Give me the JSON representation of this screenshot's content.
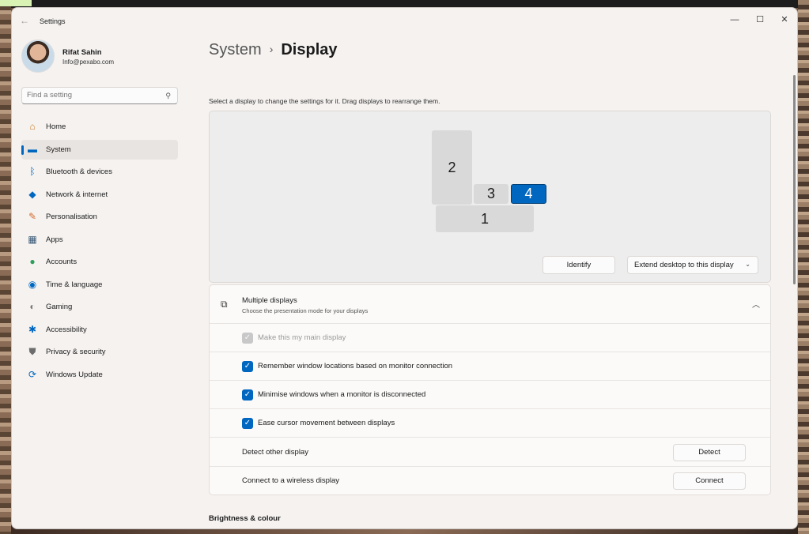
{
  "window": {
    "title": "Settings",
    "controls": {
      "minimize": "—",
      "maximize": "☐",
      "close": "✕"
    }
  },
  "profile": {
    "name": "Rifat Sahin",
    "email": "Info@pexabo.com"
  },
  "search": {
    "placeholder": "Find a setting"
  },
  "sidebar": {
    "items": [
      {
        "label": "Home",
        "icon": "home-icon",
        "glyph": "⌂",
        "color": "#c97a2a"
      },
      {
        "label": "System",
        "icon": "system-icon",
        "glyph": "▬",
        "color": "#0067c0",
        "active": true
      },
      {
        "label": "Bluetooth & devices",
        "icon": "bluetooth-icon",
        "glyph": "ᛒ",
        "color": "#0067c0"
      },
      {
        "label": "Network & internet",
        "icon": "wifi-icon",
        "glyph": "◆",
        "color": "#0067c0"
      },
      {
        "label": "Personalisation",
        "icon": "brush-icon",
        "glyph": "✎",
        "color": "#d46a2c"
      },
      {
        "label": "Apps",
        "icon": "apps-icon",
        "glyph": "▦",
        "color": "#3b5a78"
      },
      {
        "label": "Accounts",
        "icon": "person-icon",
        "glyph": "●",
        "color": "#2f9e5a"
      },
      {
        "label": "Time & language",
        "icon": "globe-clock-icon",
        "glyph": "◉",
        "color": "#0067c0"
      },
      {
        "label": "Gaming",
        "icon": "gamepad-icon",
        "glyph": "◐",
        "color": "#7a7a7a"
      },
      {
        "label": "Accessibility",
        "icon": "accessibility-icon",
        "glyph": "✱",
        "color": "#0067c0"
      },
      {
        "label": "Privacy & security",
        "icon": "shield-icon",
        "glyph": "⛊",
        "color": "#6d6d6d"
      },
      {
        "label": "Windows Update",
        "icon": "update-icon",
        "glyph": "⟳",
        "color": "#0067c0"
      }
    ]
  },
  "breadcrumb": {
    "parent": "System",
    "separator": "›",
    "current": "Display"
  },
  "arrange": {
    "instruction": "Select a display to change the settings for it. Drag displays to rearrange them.",
    "monitors": [
      {
        "number": "2",
        "selected": false
      },
      {
        "number": "3",
        "selected": false
      },
      {
        "number": "4",
        "selected": true
      },
      {
        "number": "1",
        "selected": false
      }
    ],
    "identify_label": "Identify",
    "extend_label": "Extend desktop to this display"
  },
  "multiple_displays": {
    "title": "Multiple displays",
    "subtitle": "Choose the presentation mode for your displays",
    "options": [
      {
        "label": "Make this my main display",
        "checked": true,
        "disabled": true
      },
      {
        "label": "Remember window locations based on monitor connection",
        "checked": true,
        "disabled": false
      },
      {
        "label": "Minimise windows when a monitor is disconnected",
        "checked": true,
        "disabled": false
      },
      {
        "label": "Ease cursor movement between displays",
        "checked": true,
        "disabled": false
      }
    ],
    "detect": {
      "label": "Detect other display",
      "button": "Detect"
    },
    "connect": {
      "label": "Connect to a wireless display",
      "button": "Connect"
    }
  },
  "next_section": {
    "heading": "Brightness & colour"
  },
  "colors": {
    "accent": "#0067c0",
    "window_bg": "#f5f2f0"
  }
}
